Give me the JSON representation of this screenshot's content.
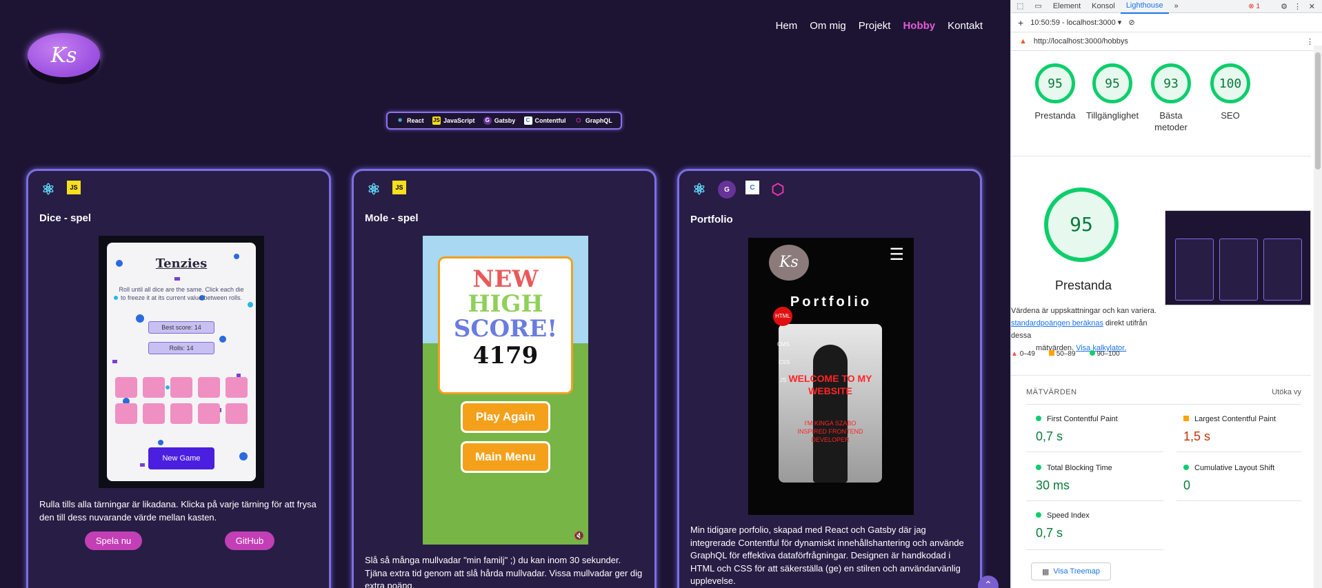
{
  "site": {
    "logo_text": "Ks",
    "nav": [
      "Hem",
      "Om mig",
      "Projekt",
      "Hobby",
      "Kontakt"
    ],
    "nav_active": "Hobby",
    "tech": [
      "React",
      "JavaScript",
      "Gatsby",
      "Contentful",
      "GraphQL"
    ],
    "cards": [
      {
        "title": "Dice - spel",
        "icons": [
          "react-icon",
          "javascript-icon"
        ],
        "shot": {
          "game_title": "Tenzies",
          "instructions": "Roll until all dice are the same. Click each die to freeze it at its current value between rolls.",
          "best_score": "Best score: 14",
          "rolls": "Rolls: 14",
          "button": "New Game"
        },
        "description": "Rulla tills alla tärningar är likadana. Klicka på varje tärning för att frysa den till dess nuvarande värde mellan kasten.",
        "buttons": [
          "Spela nu",
          "GitHub"
        ]
      },
      {
        "title": "Mole - spel",
        "icons": [
          "react-icon",
          "javascript-icon"
        ],
        "shot": {
          "line1": "NEW",
          "line2": "HIGH",
          "line3": "SCORE!",
          "score": "4179",
          "btn1": "Play Again",
          "btn2": "Main Menu"
        },
        "description": "Slå så många mullvadar \"min familj\" ;) du kan inom 30 sekunder. Tjäna extra tid genom att slå hårda mullvadar. Vissa mullvadar ger dig extra poäng."
      },
      {
        "title": "Portfolio",
        "icons": [
          "react-icon",
          "gatsby-icon",
          "contentful-icon",
          "graphql-icon"
        ],
        "shot": {
          "heading": "Portfolio",
          "skills": [
            "HTML",
            "CMS",
            "CSS",
            "JS"
          ],
          "welcome": "WELCOME TO MY WEBSITE",
          "sub": "I'M KINGA SZABO INSPIRED FRONTEND DEVELOPER"
        },
        "description": "Min tidigare porfolio, skapad med React och Gatsby där jag integrerade Contentful för dynamiskt innehållshantering och använde GraphQL för effektiva dataförfrågningar. Designen är handkodad i HTML och CSS för att säkerställa (ge) en stilren och användarvänlig upplevelse."
      }
    ]
  },
  "devtools": {
    "tabs": [
      "Element",
      "Konsol",
      "Lighthouse"
    ],
    "active_tab": "Lighthouse",
    "error_count": "1",
    "session": "10:50:59 - localhost:3000 ▾",
    "url": "http://localhost:3000/hobbys",
    "scores": [
      {
        "value": "95",
        "label": "Prestanda"
      },
      {
        "value": "95",
        "label": "Tillgänglighet"
      },
      {
        "value": "93",
        "label": "Bästa metoder"
      },
      {
        "value": "100",
        "label": "SEO"
      }
    ],
    "big_score": "95",
    "big_label": "Prestanda",
    "note_line1": "Värdena är uppskattningar och kan variera.",
    "note_link1": "standardpoängen beräknas",
    "note_line2": "direkt utifrån dessa",
    "note_line3": "mätvärden.",
    "note_link2": "Visa kalkylator.",
    "legend": [
      "0–49",
      "50–89",
      "90–100"
    ],
    "metrics_title": "MÄTVÄRDEN",
    "expand": "Utöka vy",
    "metrics": [
      {
        "name": "First Contentful Paint",
        "value": "0,7 s",
        "status": "pass"
      },
      {
        "name": "Largest Contentful Paint",
        "value": "1,5 s",
        "status": "average"
      },
      {
        "name": "Total Blocking Time",
        "value": "30 ms",
        "status": "pass"
      },
      {
        "name": "Cumulative Layout Shift",
        "value": "0",
        "status": "pass"
      },
      {
        "name": "Speed Index",
        "value": "0,7 s",
        "status": "pass"
      }
    ],
    "treemap_button": "Visa Treemap"
  }
}
